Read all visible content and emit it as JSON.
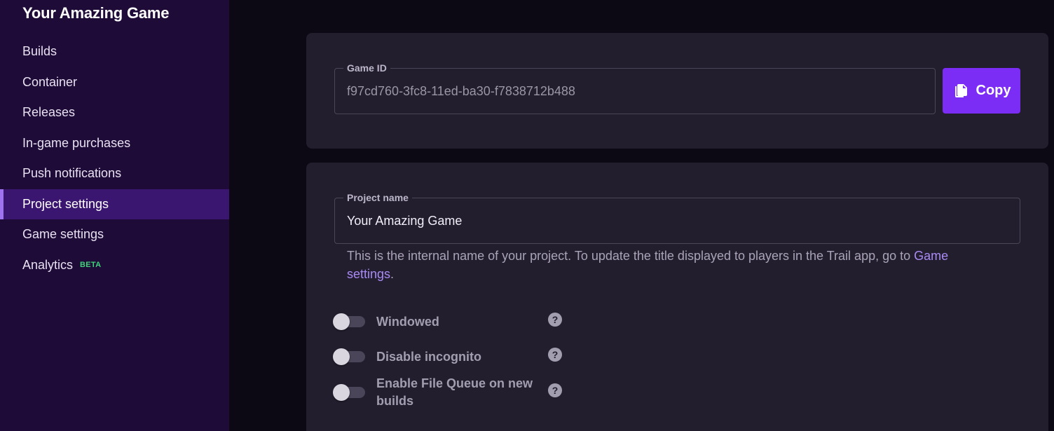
{
  "sidebar": {
    "title": "Your Amazing Game",
    "items": [
      {
        "label": "Builds"
      },
      {
        "label": "Container"
      },
      {
        "label": "Releases"
      },
      {
        "label": "In-game purchases"
      },
      {
        "label": "Push notifications"
      },
      {
        "label": "Project settings",
        "active": true
      },
      {
        "label": "Game settings"
      },
      {
        "label": "Analytics",
        "badge": "BETA"
      }
    ]
  },
  "game_id_card": {
    "field_label": "Game ID",
    "value": "f97cd760-3fc8-11ed-ba30-f7838712b488",
    "copy_label": "Copy"
  },
  "project_card": {
    "field_label": "Project name",
    "value": "Your Amazing Game",
    "helper_text": "This is the internal name of your project. To update the title displayed to players in the Trail app, go to ",
    "helper_link": "Game settings",
    "helper_end": ".",
    "toggles": [
      {
        "label": "Windowed",
        "on": false,
        "help": "?"
      },
      {
        "label": "Disable incognito",
        "on": false,
        "help": "?"
      },
      {
        "label": "Enable File Queue on new builds",
        "on": false,
        "help": "?"
      }
    ]
  },
  "colors": {
    "sidebar_bg": "#1f0b37",
    "active_item_bg": "#3a1670",
    "accent": "#7b2cf5",
    "link": "#a98af5",
    "beta": "#3fd27a"
  },
  "icons": {
    "copy": "copy-icon",
    "help": "help-icon"
  }
}
